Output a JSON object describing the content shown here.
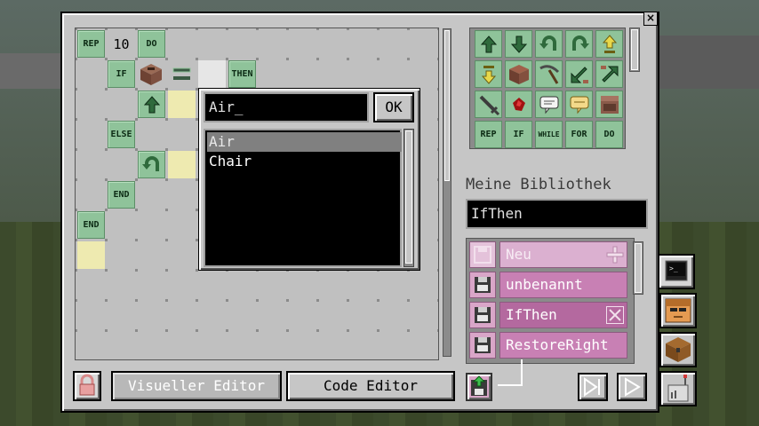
{
  "grid": {
    "rep_label": "REP",
    "rep_count": "10",
    "do_label": "DO",
    "if_label": "IF",
    "then_label": "THEN",
    "else_label": "ELSE",
    "end_inner_label": "END",
    "end_outer_label": "END",
    "icons": [
      "note-block-icon",
      "equals-icon",
      "move-up-icon",
      "turn-left-icon"
    ]
  },
  "popup": {
    "input_value": "Air_",
    "ok_label": "OK",
    "items": [
      "Air",
      "Chair"
    ],
    "selected": "Air"
  },
  "palette": {
    "row_labels": [
      "REP",
      "IF",
      "WHILE",
      "FOR",
      "DO"
    ],
    "icons": [
      "move-up-icon",
      "move-down-icon",
      "turn-left-icon",
      "turn-right-icon",
      "jump-up-icon",
      "drop-down-icon",
      "dirt-block-icon",
      "pickaxe-icon",
      "place-down-left-icon",
      "place-up-right-icon",
      "sword-icon",
      "redstone-icon",
      "chat-icon",
      "notify-icon",
      "note-block-icon"
    ]
  },
  "library": {
    "heading": "Meine Bibliothek",
    "name_value": "IfThen",
    "items": [
      {
        "label": "Neu",
        "state": "new"
      },
      {
        "label": "unbenannt",
        "state": "normal"
      },
      {
        "label": "IfThen",
        "state": "selected"
      },
      {
        "label": "RestoreRight",
        "state": "normal"
      }
    ]
  },
  "bottom": {
    "visual_editor_label": "Visueller Editor",
    "code_editor_label": "Code Editor"
  },
  "sidetabs": [
    "terminal-icon",
    "robot-face-icon",
    "chest-icon",
    "antenna-device-icon"
  ]
}
